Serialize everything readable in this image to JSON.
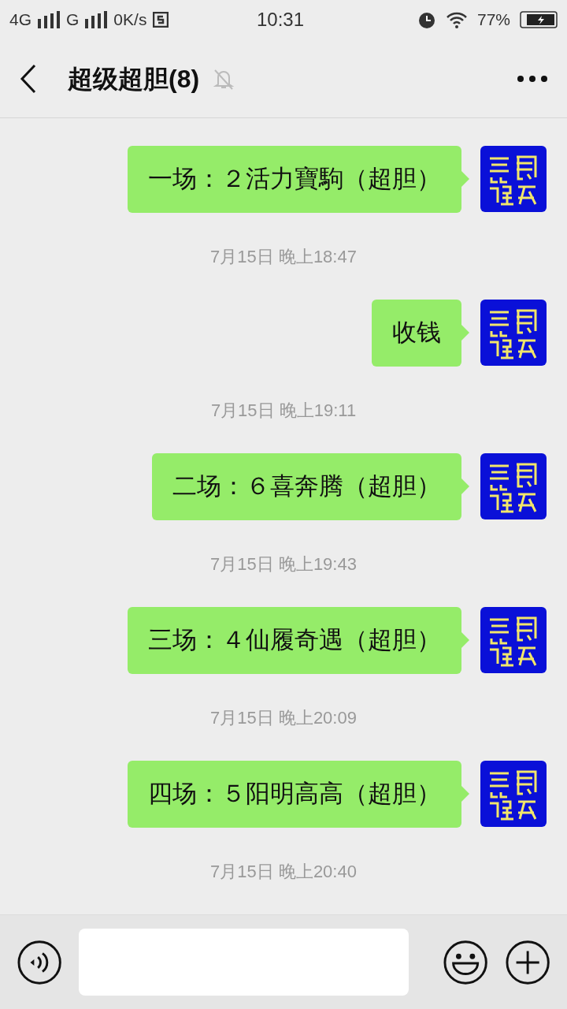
{
  "status_bar": {
    "network_1": "4G",
    "network_2": "G",
    "speed": "0K/s",
    "time": "10:31",
    "battery": "77%"
  },
  "header": {
    "title": "超级超胆(8)",
    "muted": true
  },
  "messages": [
    {
      "text": "一场：２活力寶駒（超胆）",
      "time": "7月15日 晚上18:47"
    },
    {
      "text": "收钱",
      "time": "7月15日 晚上19:11"
    },
    {
      "text": "二场：６喜奔腾（超胆）",
      "time": "7月15日 晚上19:43"
    },
    {
      "text": "三场：４仙履奇遇（超胆）",
      "time": "7月15日 晚上20:09"
    },
    {
      "text": "四场：５阳明高高（超胆）",
      "time": "7月15日 晚上20:40"
    }
  ]
}
